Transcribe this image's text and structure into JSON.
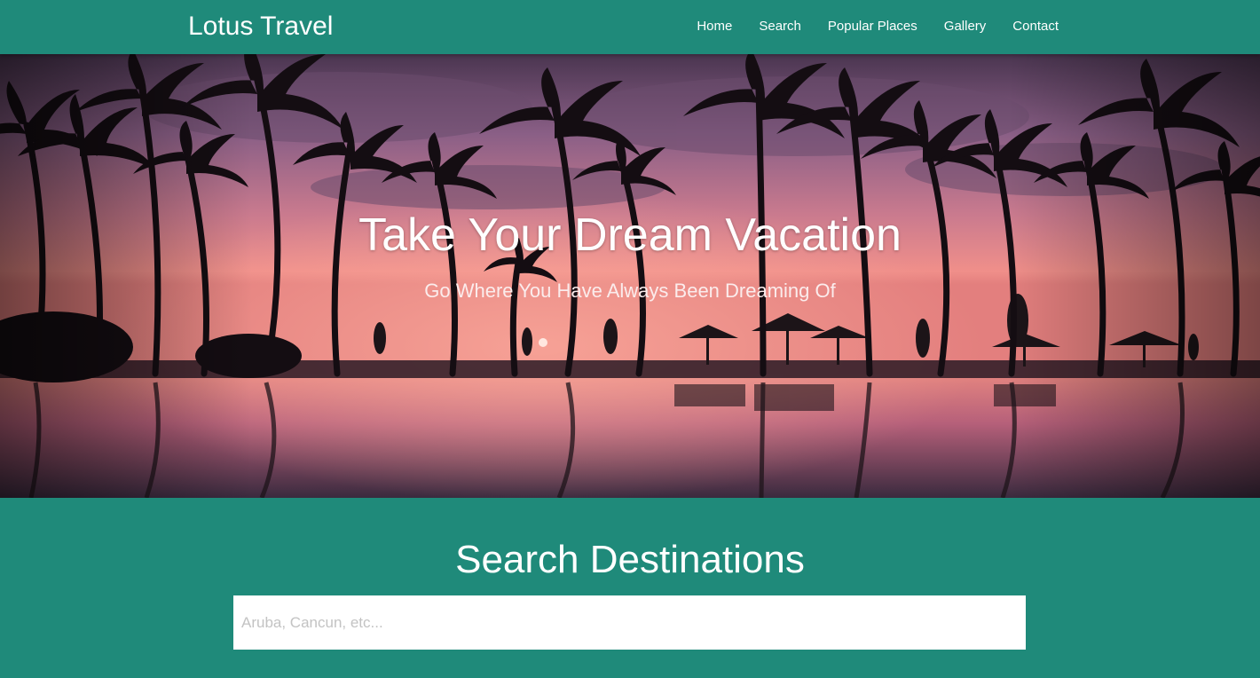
{
  "navbar": {
    "brand": "Lotus Travel",
    "links": [
      {
        "label": "Home"
      },
      {
        "label": "Search"
      },
      {
        "label": "Popular Places"
      },
      {
        "label": "Gallery"
      },
      {
        "label": "Contact"
      }
    ]
  },
  "hero": {
    "title": "Take Your Dream Vacation",
    "subtitle": "Go Where You Have Always Been Dreaming Of",
    "image": "tropical-sunset-palm-trees-pool"
  },
  "search": {
    "title": "Search Destinations",
    "placeholder": "Aruba, Cancun, etc...",
    "value": ""
  },
  "colors": {
    "primary": "#1f8a7a",
    "text": "#ffffff"
  }
}
